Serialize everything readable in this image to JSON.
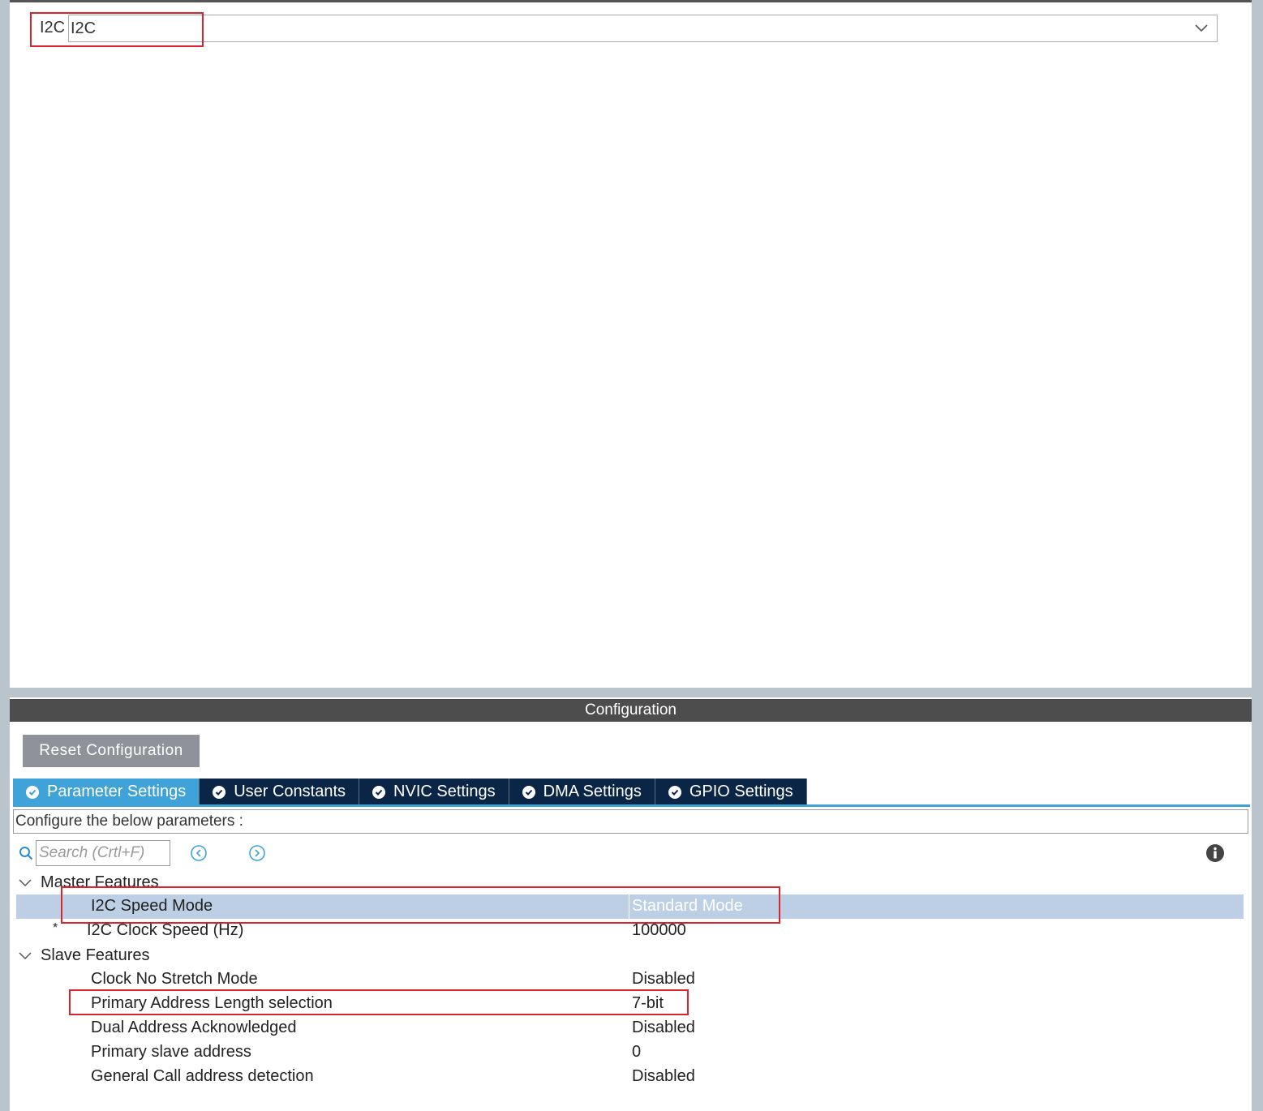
{
  "mode": {
    "label": "I2C",
    "selected": "I2C"
  },
  "config": {
    "header": "Configuration",
    "reset_label": "Reset Configuration",
    "tabs": [
      {
        "label": "Parameter Settings",
        "active": true
      },
      {
        "label": "User Constants",
        "active": false
      },
      {
        "label": "NVIC Settings",
        "active": false
      },
      {
        "label": "DMA Settings",
        "active": false
      },
      {
        "label": "GPIO Settings",
        "active": false
      }
    ],
    "description": "Configure the below parameters :",
    "search_placeholder": "Search (Crtl+F)",
    "groups": {
      "master": {
        "label": "Master Features",
        "params": [
          {
            "name": "I2C Speed Mode",
            "value": "Standard Mode",
            "selected": true
          },
          {
            "name": "I2C Clock Speed (Hz)",
            "value": "100000",
            "modified": "*"
          }
        ]
      },
      "slave": {
        "label": "Slave Features",
        "params": [
          {
            "name": "Clock No Stretch Mode",
            "value": "Disabled"
          },
          {
            "name": "Primary Address Length selection",
            "value": "7-bit"
          },
          {
            "name": "Dual Address Acknowledged",
            "value": "Disabled"
          },
          {
            "name": "Primary slave address",
            "value": "0"
          },
          {
            "name": "General Call address detection",
            "value": "Disabled"
          }
        ]
      }
    }
  },
  "colors": {
    "highlight_border": "#d9232d",
    "active_tab": "#3fa3d9",
    "inactive_tab": "#0b2547",
    "selected_row": "#bccfe4"
  },
  "icons": [
    "chevron-down-icon",
    "check-circle-icon",
    "search-icon",
    "previous-icon",
    "next-icon",
    "info-icon",
    "collapse-chevron-icon"
  ]
}
